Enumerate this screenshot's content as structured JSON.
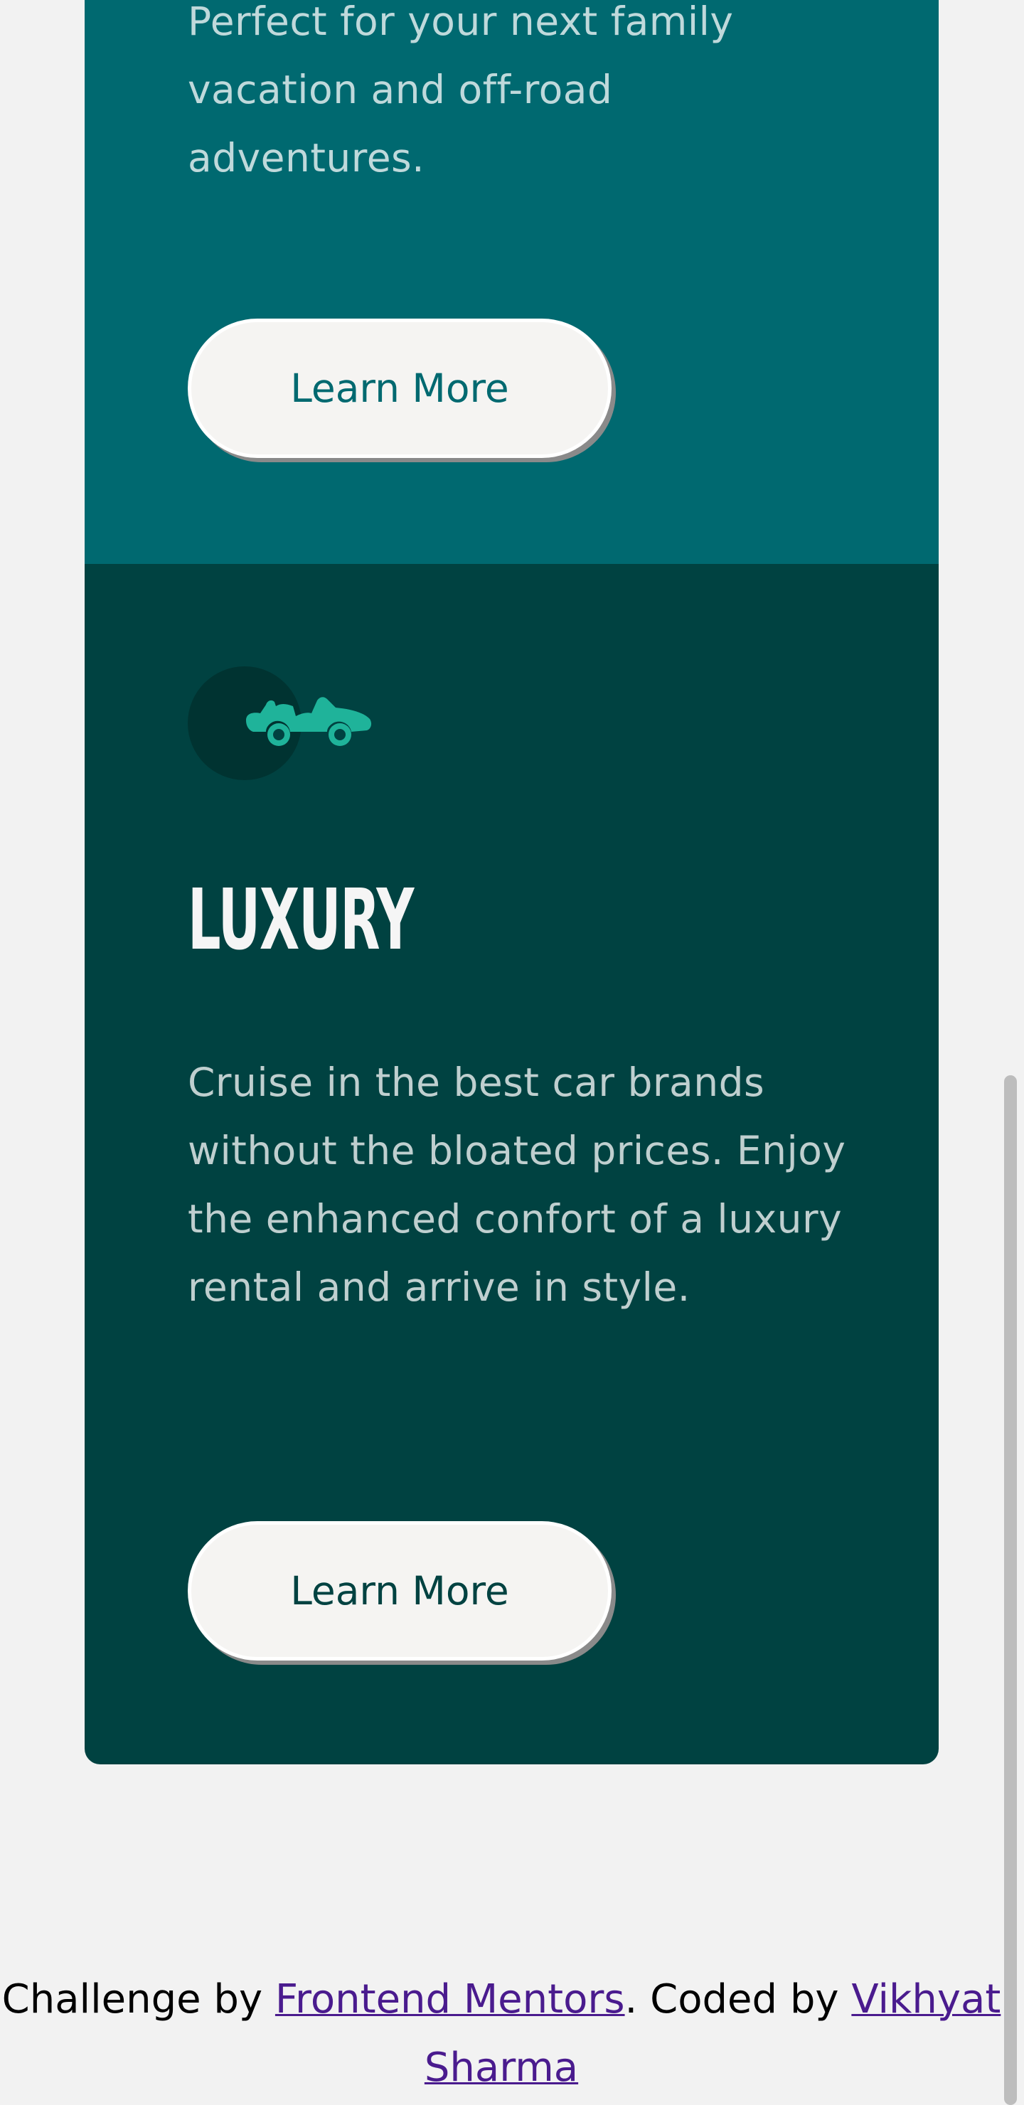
{
  "suv_card": {
    "description": "Perfect for your next family vacation and off-road adventures.",
    "button_label": "Learn More"
  },
  "luxury_card": {
    "icon": "luxury-car-icon",
    "title": "LUXURY",
    "description": "Cruise in the best car brands without the bloated prices. Enjoy the enhanced confort of a luxury rental and arrive in style.",
    "button_label": "Learn More"
  },
  "footer": {
    "prefix": "Challenge by",
    "link1": "Frontend Mentors",
    "middle": ". Coded by",
    "link2": "Vikhyat Sharma"
  },
  "colors": {
    "page_bg": "#f2f2f2",
    "suv_bg": "#006970",
    "luxury_bg": "#004241",
    "icon_accent": "#1fb39a",
    "link": "#4a1b8e"
  }
}
